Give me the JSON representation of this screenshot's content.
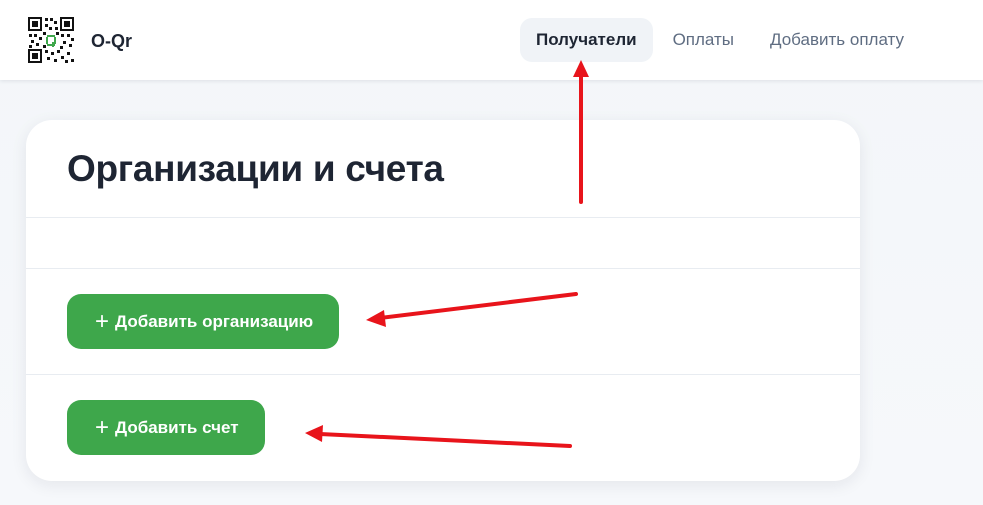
{
  "brand": {
    "name": "O-Qr"
  },
  "nav": {
    "items": [
      {
        "label": "Получатели",
        "active": true
      },
      {
        "label": "Оплаты",
        "active": false
      },
      {
        "label": "Добавить оплату",
        "active": false
      }
    ]
  },
  "card": {
    "title": "Организации и счета",
    "add_org_label": "Добавить организацию",
    "add_account_label": "Добавить счет",
    "plus_icon": "+"
  },
  "colors": {
    "accent_green": "#3ea74b",
    "annotation_red": "#e8141b",
    "heading": "#1e2533",
    "nav_text": "#5f6d82"
  },
  "icons": [
    "qr-code-logo-icon",
    "plus-icon"
  ]
}
